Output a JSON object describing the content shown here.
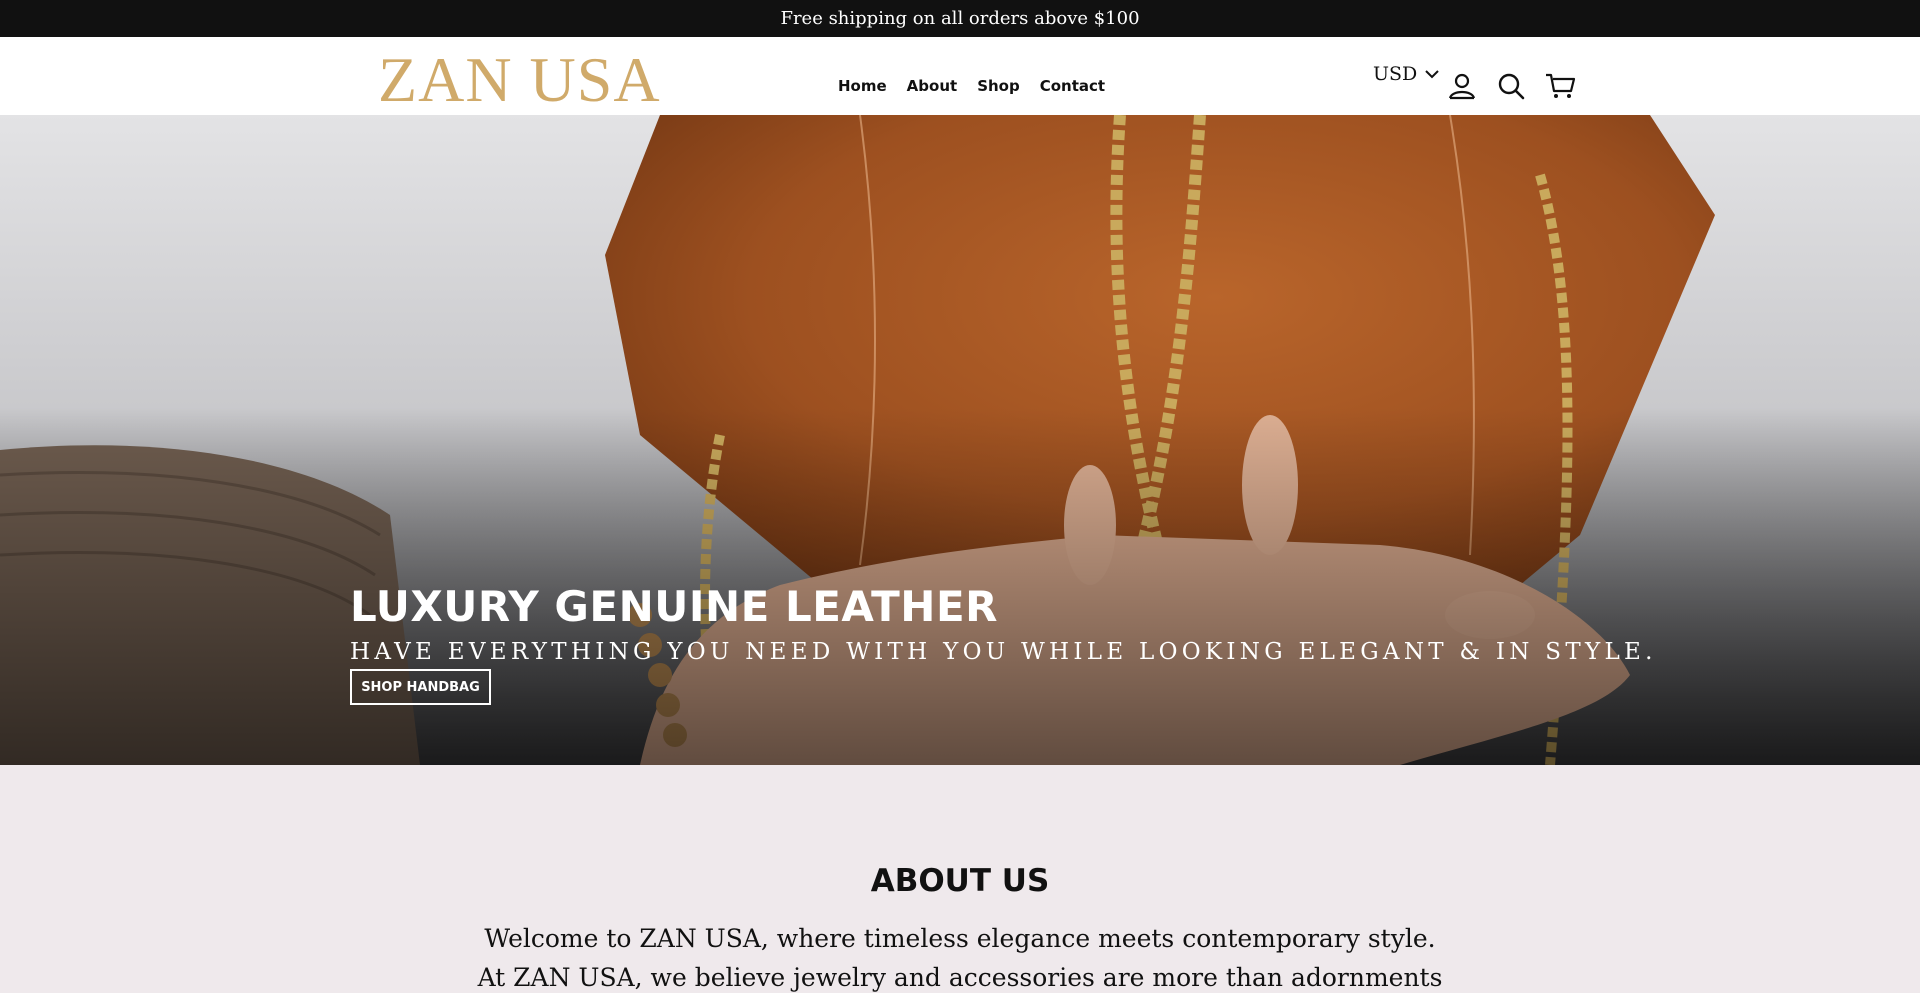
{
  "announcement": "Free shipping on all orders above $100",
  "brand": {
    "logo_text": "ZAN USA",
    "accent": "#d0aa6a"
  },
  "nav": [
    {
      "label": "Home"
    },
    {
      "label": "About"
    },
    {
      "label": "Shop"
    },
    {
      "label": "Contact"
    }
  ],
  "currency": {
    "selected": "USD"
  },
  "icons": {
    "account": "user-icon",
    "search": "search-icon",
    "cart": "cart-icon"
  },
  "hero": {
    "title": "LUXURY GENUINE LEATHER",
    "subtitle": "HAVE EVERYTHING YOU NEED WITH YOU WHILE LOOKING ELEGANT & IN STYLE.",
    "cta": "SHOP HANDBAG"
  },
  "about": {
    "heading": "ABOUT US",
    "line1": "Welcome to ZAN USA, where timeless elegance meets contemporary style.",
    "line2": "At ZAN USA, we believe jewelry and accessories are more than adornments"
  }
}
